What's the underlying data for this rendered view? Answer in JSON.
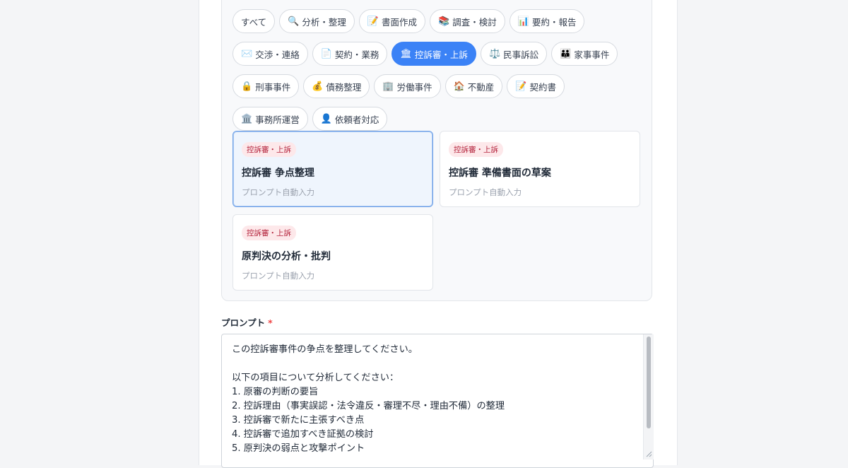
{
  "categories": [
    {
      "icon": "",
      "label": "すべて",
      "active": false
    },
    {
      "icon": "🔍",
      "label": "分析・整理",
      "active": false
    },
    {
      "icon": "📝",
      "label": "書面作成",
      "active": false
    },
    {
      "icon": "📚",
      "label": "調査・検討",
      "active": false
    },
    {
      "icon": "📊",
      "label": "要約・報告",
      "active": false
    },
    {
      "icon": "✉️",
      "label": "交渉・連絡",
      "active": false
    },
    {
      "icon": "📄",
      "label": "契約・業務",
      "active": false
    },
    {
      "icon": "🏛",
      "label": "控訴審・上訴",
      "active": true
    },
    {
      "icon": "⚖️",
      "label": "民事訴訟",
      "active": false
    },
    {
      "icon": "👪",
      "label": "家事事件",
      "active": false
    },
    {
      "icon": "🔒",
      "label": "刑事事件",
      "active": false
    },
    {
      "icon": "💰",
      "label": "債務整理",
      "active": false
    },
    {
      "icon": "🏢",
      "label": "労働事件",
      "active": false
    },
    {
      "icon": "🏠",
      "label": "不動産",
      "active": false
    },
    {
      "icon": "📝",
      "label": "契約書",
      "active": false
    },
    {
      "icon": "🏛️",
      "label": "事務所運営",
      "active": false
    },
    {
      "icon": "👤",
      "label": "依頼者対応",
      "active": false
    }
  ],
  "templates": [
    {
      "badge": "控訴審・上訴",
      "title": "控訴審 争点整理",
      "desc": "プロンプト自動入力",
      "selected": true
    },
    {
      "badge": "控訴審・上訴",
      "title": "控訴審 準備書面の草案",
      "desc": "プロンプト自動入力",
      "selected": false
    },
    {
      "badge": "控訴審・上訴",
      "title": "原判決の分析・批判",
      "desc": "プロンプト自動入力",
      "selected": false
    }
  ],
  "prompt": {
    "label": "プロンプト",
    "required_mark": "*",
    "value": "この控訴審事件の争点を整理してください。\n\n以下の項目について分析してください：\n1. 原審の判断の要旨\n2. 控訴理由（事実誤認・法令違反・審理不尽・理由不備）の整理\n3. 控訴審で新たに主張すべき点\n4. 控訴審で追加すべき証拠の検討\n5. 原判決の弱点と攻撃ポイント"
  },
  "colors": {
    "accent": "#3b82f6",
    "badge_bg": "#fde8ea",
    "badge_text": "#b4233c",
    "required": "#ef4444"
  }
}
